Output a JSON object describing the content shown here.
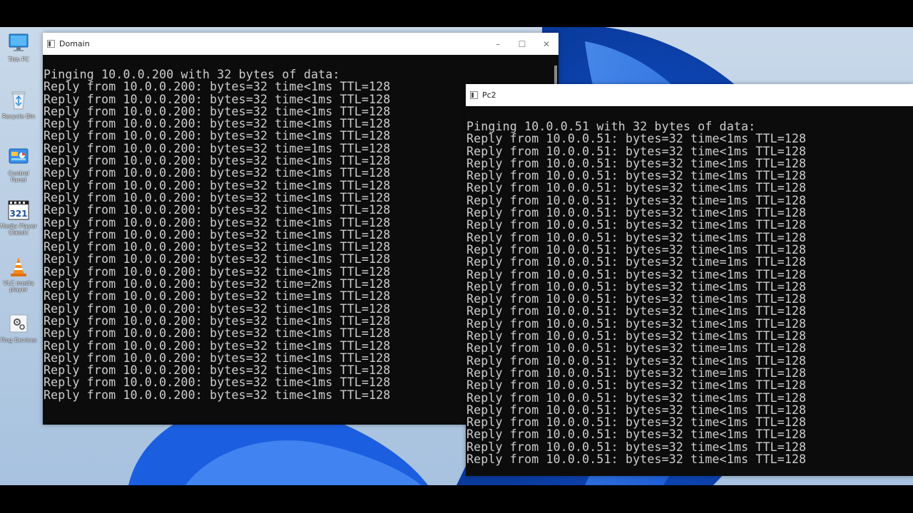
{
  "desktop": {
    "icons": [
      {
        "label": "This PC",
        "icon": "monitor-icon"
      },
      {
        "label": "Recycle Bin",
        "icon": "recycle-bin-icon"
      },
      {
        "label": "Control Panel",
        "icon": "control-panel-icon"
      },
      {
        "label": "Media Player Classic",
        "icon": "media-player-classic-icon"
      },
      {
        "label": "VLC media player",
        "icon": "vlc-cone-icon"
      },
      {
        "label": "Ping Devices",
        "icon": "gear-document-icon"
      }
    ]
  },
  "windows": {
    "domain": {
      "title": "Domain",
      "controls": {
        "minimize": "–",
        "maximize": "☐",
        "close": "✕"
      },
      "lines": [
        "Pinging 10.0.0.200 with 32 bytes of data:",
        "Reply from 10.0.0.200: bytes=32 time<1ms TTL=128",
        "Reply from 10.0.0.200: bytes=32 time<1ms TTL=128",
        "Reply from 10.0.0.200: bytes=32 time<1ms TTL=128",
        "Reply from 10.0.0.200: bytes=32 time<1ms TTL=128",
        "Reply from 10.0.0.200: bytes=32 time<1ms TTL=128",
        "Reply from 10.0.0.200: bytes=32 time=1ms TTL=128",
        "Reply from 10.0.0.200: bytes=32 time<1ms TTL=128",
        "Reply from 10.0.0.200: bytes=32 time<1ms TTL=128",
        "Reply from 10.0.0.200: bytes=32 time<1ms TTL=128",
        "Reply from 10.0.0.200: bytes=32 time<1ms TTL=128",
        "Reply from 10.0.0.200: bytes=32 time<1ms TTL=128",
        "Reply from 10.0.0.200: bytes=32 time<1ms TTL=128",
        "Reply from 10.0.0.200: bytes=32 time<1ms TTL=128",
        "Reply from 10.0.0.200: bytes=32 time<1ms TTL=128",
        "Reply from 10.0.0.200: bytes=32 time<1ms TTL=128",
        "Reply from 10.0.0.200: bytes=32 time<1ms TTL=128",
        "Reply from 10.0.0.200: bytes=32 time=2ms TTL=128",
        "Reply from 10.0.0.200: bytes=32 time=1ms TTL=128",
        "Reply from 10.0.0.200: bytes=32 time<1ms TTL=128",
        "Reply from 10.0.0.200: bytes=32 time<1ms TTL=128",
        "Reply from 10.0.0.200: bytes=32 time<1ms TTL=128",
        "Reply from 10.0.0.200: bytes=32 time<1ms TTL=128",
        "Reply from 10.0.0.200: bytes=32 time<1ms TTL=128",
        "Reply from 10.0.0.200: bytes=32 time<1ms TTL=128",
        "Reply from 10.0.0.200: bytes=32 time<1ms TTL=128",
        "Reply from 10.0.0.200: bytes=32 time<1ms TTL=128"
      ]
    },
    "pc2": {
      "title": "Pc2",
      "lines": [
        "Pinging 10.0.0.51 with 32 bytes of data:",
        "Reply from 10.0.0.51: bytes=32 time<1ms TTL=128",
        "Reply from 10.0.0.51: bytes=32 time<1ms TTL=128",
        "Reply from 10.0.0.51: bytes=32 time<1ms TTL=128",
        "Reply from 10.0.0.51: bytes=32 time<1ms TTL=128",
        "Reply from 10.0.0.51: bytes=32 time<1ms TTL=128",
        "Reply from 10.0.0.51: bytes=32 time=1ms TTL=128",
        "Reply from 10.0.0.51: bytes=32 time<1ms TTL=128",
        "Reply from 10.0.0.51: bytes=32 time<1ms TTL=128",
        "Reply from 10.0.0.51: bytes=32 time<1ms TTL=128",
        "Reply from 10.0.0.51: bytes=32 time<1ms TTL=128",
        "Reply from 10.0.0.51: bytes=32 time=1ms TTL=128",
        "Reply from 10.0.0.51: bytes=32 time<1ms TTL=128",
        "Reply from 10.0.0.51: bytes=32 time<1ms TTL=128",
        "Reply from 10.0.0.51: bytes=32 time<1ms TTL=128",
        "Reply from 10.0.0.51: bytes=32 time<1ms TTL=128",
        "Reply from 10.0.0.51: bytes=32 time<1ms TTL=128",
        "Reply from 10.0.0.51: bytes=32 time<1ms TTL=128",
        "Reply from 10.0.0.51: bytes=32 time=1ms TTL=128",
        "Reply from 10.0.0.51: bytes=32 time<1ms TTL=128",
        "Reply from 10.0.0.51: bytes=32 time=1ms TTL=128",
        "Reply from 10.0.0.51: bytes=32 time<1ms TTL=128",
        "Reply from 10.0.0.51: bytes=32 time<1ms TTL=128",
        "Reply from 10.0.0.51: bytes=32 time<1ms TTL=128",
        "Reply from 10.0.0.51: bytes=32 time<1ms TTL=128",
        "Reply from 10.0.0.51: bytes=32 time<1ms TTL=128",
        "Reply from 10.0.0.51: bytes=32 time<1ms TTL=128",
        "Reply from 10.0.0.51: bytes=32 time<1ms TTL=128"
      ]
    }
  }
}
